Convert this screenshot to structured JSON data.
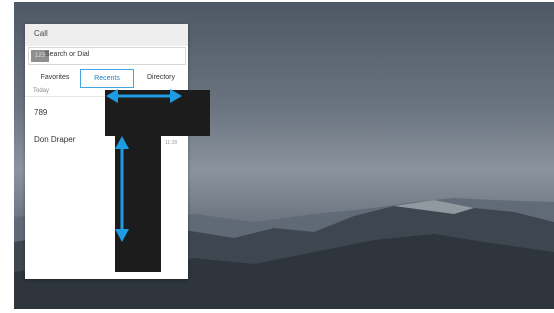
{
  "panel": {
    "title": "Call",
    "search": {
      "dialpad_label": "123",
      "placeholder": "Search or Dial"
    },
    "tabs": [
      {
        "label": "Favorites",
        "active": false
      },
      {
        "label": "Recents",
        "active": true
      },
      {
        "label": "Directory",
        "active": false
      }
    ],
    "section_label": "Today",
    "recents": [
      {
        "name": "789",
        "time": ""
      },
      {
        "name": "Don Draper",
        "time": "11:28"
      }
    ]
  },
  "colors": {
    "accent": "#44a5e2",
    "arrow": "#1e9be2",
    "redaction": "#1c1c1c"
  },
  "icons": [
    "dialpad-icon",
    "horizontal-resize-arrow-icon",
    "vertical-resize-arrow-icon"
  ]
}
